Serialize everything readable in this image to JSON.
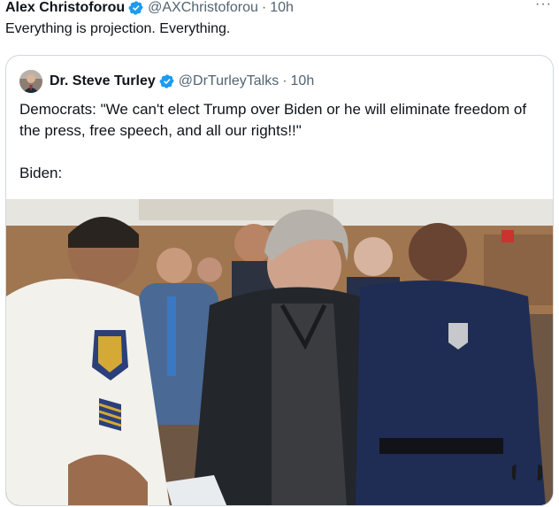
{
  "tweet": {
    "author_name": "Alex Christoforou",
    "author_handle": "@AXChristoforou",
    "separator": "·",
    "time": "10h",
    "text": "Everything is projection. Everything.",
    "more_label": "···"
  },
  "quoted_tweet": {
    "author_name": "Dr. Steve Turley",
    "author_handle": "@DrTurleyTalks",
    "separator": "·",
    "time": "10h",
    "text": "Democrats: \"We can't elect Trump over Biden or he will eliminate freedom of the press, free speech, and all our rights!!\"\n\nBiden:",
    "image_description": "courtroom photo"
  },
  "colors": {
    "verified_blue": "#1d9bf0",
    "secondary_text": "#536471",
    "border": "#cfd9de"
  },
  "icons": {
    "verified": "verified-badge-icon",
    "more": "more-options-icon"
  }
}
